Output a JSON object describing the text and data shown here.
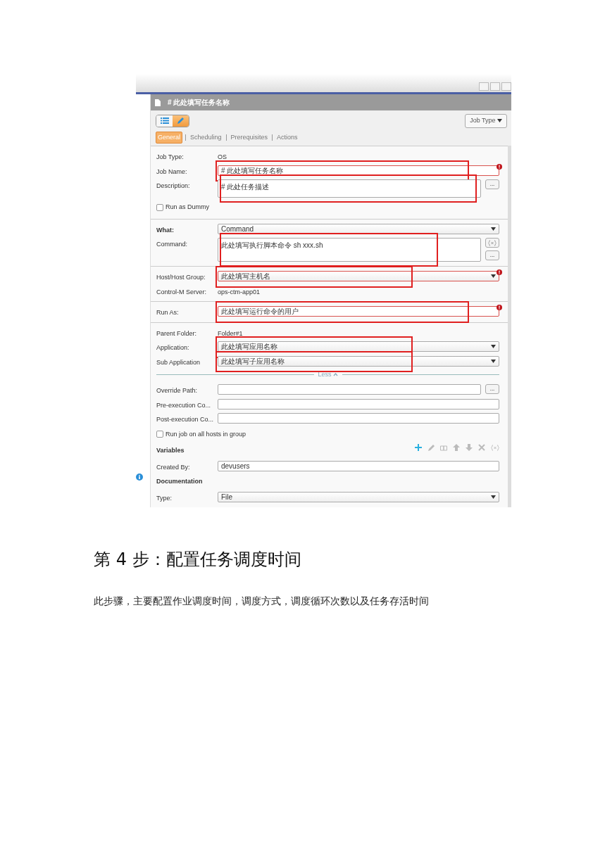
{
  "editor": {
    "title": "# 此处填写任务名称",
    "view_toggle": [
      {
        "kind": "list",
        "selected": false
      },
      {
        "kind": "edit",
        "selected": true
      }
    ],
    "job_type_button": "Job Type",
    "tabs": [
      {
        "label": "General",
        "selected": true
      },
      {
        "label": "Scheduling",
        "selected": false
      },
      {
        "label": "Prerequisites",
        "selected": false
      },
      {
        "label": "Actions",
        "selected": false
      }
    ],
    "sections": [
      {
        "rows": [
          {
            "kind": "static",
            "label": "Job Type:",
            "value": "OS"
          },
          {
            "kind": "input",
            "label": "Job Name:",
            "value": "# 此处填写任务名称",
            "required": true,
            "annotated": true
          },
          {
            "kind": "textarea",
            "label": "Description:",
            "value": "# 此处任务描述",
            "browse": "...",
            "annotated": true
          },
          {
            "kind": "checkbox",
            "label": "Run as Dummy",
            "checked": false
          }
        ]
      },
      {
        "rows": [
          {
            "kind": "select",
            "label": "What:",
            "value": "Command",
            "bold": true
          },
          {
            "kind": "textarea",
            "label": "Command:",
            "value": "此处填写执行脚本命令  sh xxx.sh",
            "browse": "...",
            "variable_button": true,
            "annotated": true
          }
        ]
      },
      {
        "rows": [
          {
            "kind": "select",
            "label": "Host/Host Group:",
            "value": "此处填写主机名",
            "required": true,
            "annotated": true
          },
          {
            "kind": "static",
            "label": "Control-M Server:",
            "value": "ops-ctm-app01"
          }
        ]
      },
      {
        "rows": [
          {
            "kind": "input",
            "label": "Run As:",
            "value": "此处填写运行命令的用户",
            "required": true,
            "annotated": true
          }
        ]
      },
      {
        "rows": [
          {
            "kind": "static",
            "label": "Parent Folder:",
            "value": "Folder#1"
          },
          {
            "kind": "select",
            "label": "Application:",
            "value": "此处填写应用名称",
            "annotated": true
          },
          {
            "kind": "select",
            "label": "Sub Application",
            "value": "此处填写子应用名称",
            "annotated": true
          },
          {
            "kind": "less",
            "label": "Less"
          },
          {
            "kind": "input",
            "label": "Override Path:",
            "browse": "..."
          },
          {
            "kind": "input",
            "label": "Pre-execution Co..."
          },
          {
            "kind": "input",
            "label": "Post-execution Co..."
          },
          {
            "kind": "checkbox",
            "label": "Run job on all hosts in group",
            "checked": false
          },
          {
            "kind": "toolbar",
            "label": "Variables",
            "tools": [
              {
                "kind": "add",
                "disabled": false
              },
              {
                "kind": "edit",
                "disabled": true
              },
              {
                "kind": "copy",
                "disabled": true
              },
              {
                "kind": "up",
                "disabled": true
              },
              {
                "kind": "down",
                "disabled": true
              },
              {
                "kind": "delete",
                "disabled": true
              },
              {
                "kind": "variable",
                "disabled": true
              }
            ]
          },
          {
            "kind": "input",
            "label": "Created By:",
            "value": "devusers"
          },
          {
            "kind": "header",
            "label": "Documentation"
          },
          {
            "kind": "select",
            "label": "Type:",
            "value": "File"
          }
        ]
      }
    ]
  },
  "heading": "第 4 步：配置任务调度时间",
  "paragraph": "此步骤，主要配置作业调度时间，调度方式，调度循环次数以及任务存活时间"
}
